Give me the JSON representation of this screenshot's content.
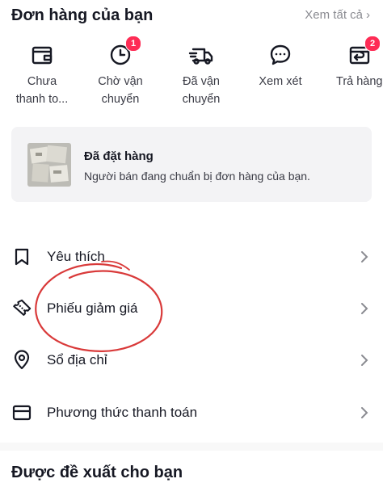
{
  "orders": {
    "title": "Đơn hàng của bạn",
    "view_all": "Xem tất cả"
  },
  "status_items": [
    {
      "line1": "Chưa",
      "line2": "thanh to...",
      "icon": "wallet-icon",
      "badge": ""
    },
    {
      "line1": "Chờ vận",
      "line2": "chuyển",
      "icon": "clock-icon",
      "badge": "1"
    },
    {
      "line1": "Đã vận",
      "line2": "chuyển",
      "icon": "truck-icon",
      "badge": ""
    },
    {
      "line1": "Xem xét",
      "line2": "",
      "icon": "chat-bubble-icon",
      "badge": ""
    },
    {
      "line1": "Trả hàng",
      "line2": "",
      "icon": "return-box-icon",
      "badge": "2"
    }
  ],
  "latest_order": {
    "title": "Đã đặt hàng",
    "subtitle": "Người bán đang chuẩn bị đơn hàng của bạn."
  },
  "menu": [
    {
      "label": "Yêu thích",
      "icon": "bookmark-icon"
    },
    {
      "label": "Phiếu giảm giá",
      "icon": "coupon-icon"
    },
    {
      "label": "Sổ địa chỉ",
      "icon": "location-pin-icon"
    },
    {
      "label": "Phương thức thanh toán",
      "icon": "card-icon"
    }
  ],
  "recommended": {
    "title": "Được đề xuất cho bạn"
  },
  "colors": {
    "badge": "#fe2c55",
    "annotation_circle": "#d93a3a",
    "card_bg": "#f3f3f5"
  }
}
